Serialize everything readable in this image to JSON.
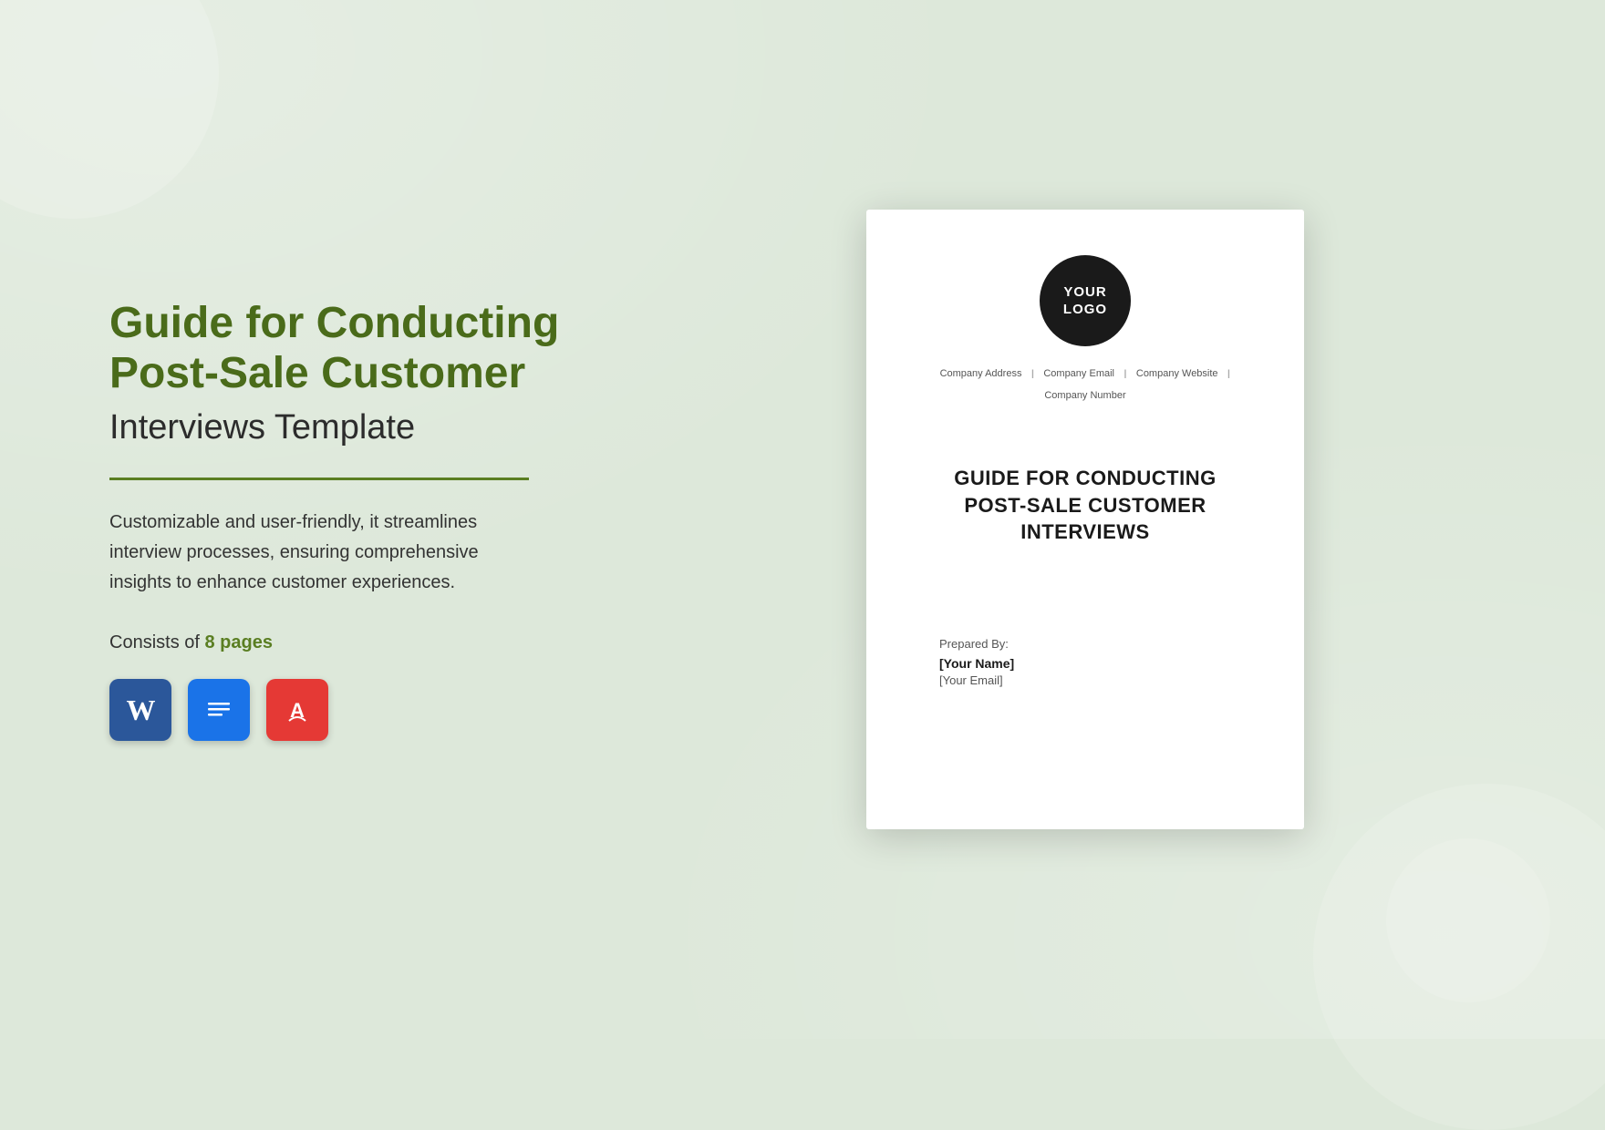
{
  "background": {
    "color": "#dde8da"
  },
  "left": {
    "title_bold": "Guide for Conducting",
    "title_bold2": "Post-Sale Customer",
    "title_normal": "Interviews Template",
    "description": "Customizable and user-friendly, it streamlines interview processes, ensuring comprehensive insights to enhance customer experiences.",
    "pages_prefix": "Consists of ",
    "pages_count": "8 pages",
    "file_icons": [
      {
        "type": "word",
        "label": "W"
      },
      {
        "type": "docs",
        "label": "≡"
      },
      {
        "type": "pdf",
        "label": "A"
      }
    ]
  },
  "document": {
    "logo_line1": "YOUR",
    "logo_line2": "LOGO",
    "company_address": "Company Address",
    "company_email": "Company Email",
    "company_website": "Company Website",
    "company_number": "Company Number",
    "separator": "I",
    "main_title": "GUIDE FOR CONDUCTING\nPOST-SALE CUSTOMER\nINTERVIEWS",
    "prepared_label": "Prepared By:",
    "prepared_name": "[Your Name]",
    "prepared_email": "[Your Email]"
  }
}
